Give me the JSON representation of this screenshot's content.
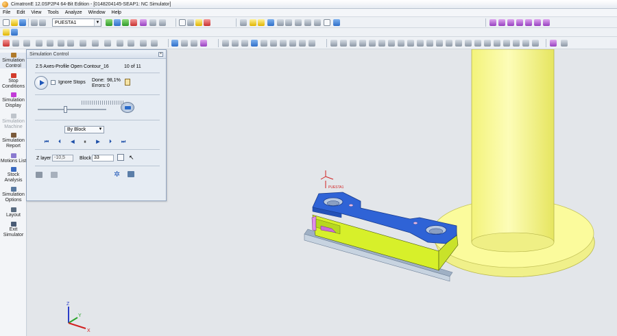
{
  "window": {
    "title": "CimatronE 12.0SP2P4  64-Bit Edition - [0148204145-SEAP1: NC Simulator]"
  },
  "menu": {
    "items": [
      "File",
      "Edit",
      "View",
      "Tools",
      "Analyze",
      "Window",
      "Help"
    ]
  },
  "toolbar": {
    "combo_value": "PUESTA1"
  },
  "left_panel": {
    "items": [
      {
        "label": "Simulation Control",
        "enabled": true,
        "selected": true
      },
      {
        "label": "Stop Conditions",
        "enabled": true
      },
      {
        "label": "Simulation Display",
        "enabled": true
      },
      {
        "label": "Simulation Machine",
        "enabled": false
      },
      {
        "label": "Simulation Report",
        "enabled": true
      },
      {
        "label": "Motions List",
        "enabled": true
      },
      {
        "label": "Stock Analysis",
        "enabled": true
      },
      {
        "label": "Simulation Options",
        "enabled": true
      },
      {
        "label": "Layout",
        "enabled": true
      },
      {
        "label": "Exit Simulator",
        "enabled": true
      }
    ]
  },
  "sim_control": {
    "title": "Simulation Control",
    "procedure": "2.5 Axes-Profile Open Contour_16",
    "procedure_index": "10 of 11",
    "ignore_stops_label": "Ignore Stops",
    "ignore_stops_checked": false,
    "done_label": "Done:",
    "done_value": "98,1%",
    "errors_label": "Errors:",
    "errors_value": "0",
    "speed_fraction": 0.4,
    "step_mode": "By Block",
    "z_layer_label": "Z layer",
    "z_layer_value": "-10,5",
    "block_label": "Block",
    "block_value": "33"
  },
  "part_label": "PUESTA1",
  "triad": {
    "x": "X",
    "y": "Y",
    "z": "Z"
  },
  "colors": {
    "part_top": "#2f63d6",
    "part_body": "#d7f02a",
    "fixture": "#fbfb9c",
    "base_plate": "#b9c7d6",
    "viewport_bg": "#e3e6ea"
  }
}
